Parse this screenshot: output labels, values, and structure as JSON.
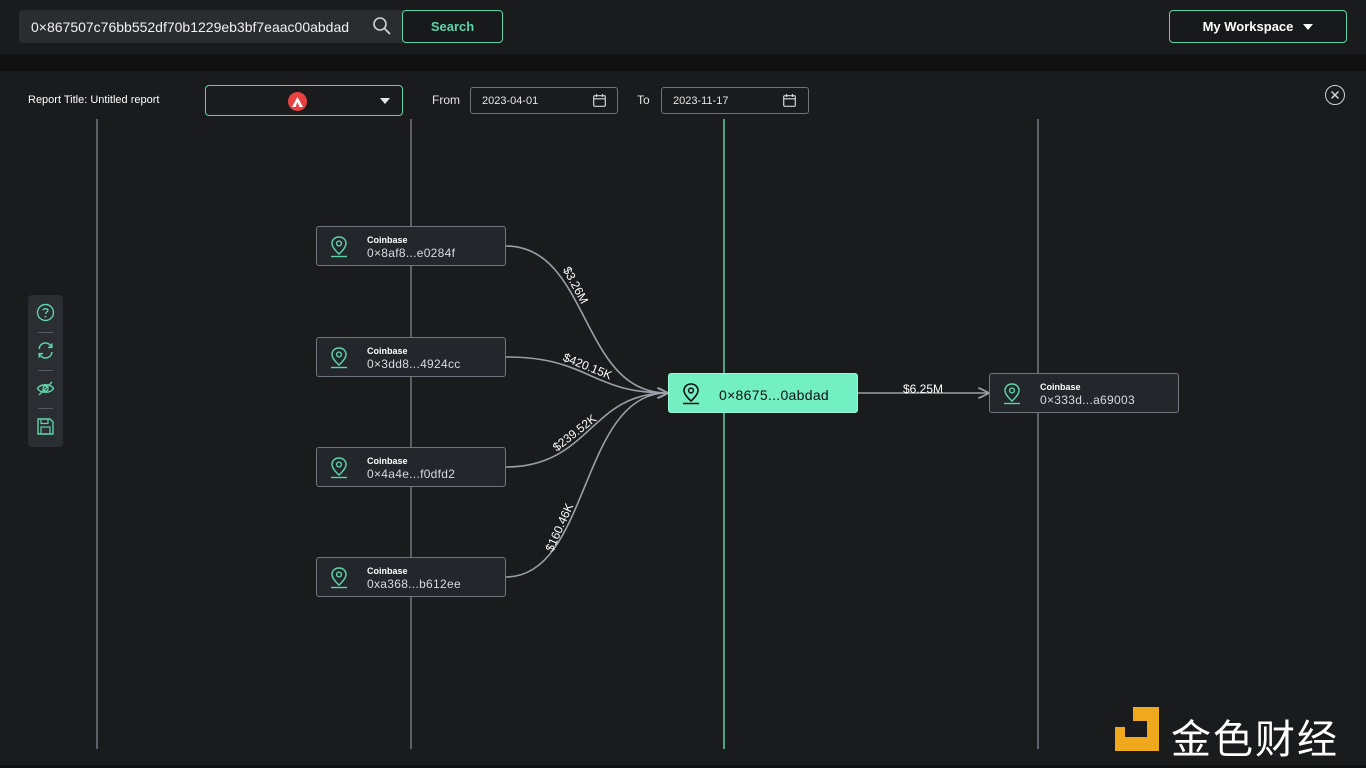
{
  "search": {
    "value": "0×867507c76bb552df70b1229eb3bf7eaac00abdad",
    "button_label": "Search"
  },
  "workspace": {
    "label": "My Workspace"
  },
  "report": {
    "title": "Report Title: Untitled report",
    "from_label": "From",
    "to_label": "To",
    "from_date": "2023-04-01",
    "to_date": "2023-11-17"
  },
  "colors": {
    "accent": "#5fd3a8",
    "center_node": "#72f0c4",
    "avalanche": "#e84142"
  },
  "toolbar": [
    "help-icon",
    "refresh-icon",
    "hide-icon",
    "save-icon"
  ],
  "sources": [
    {
      "label": "Coinbase",
      "address": "0×8af8...e0284f",
      "amount": "$3.26M"
    },
    {
      "label": "Coinbase",
      "address": "0×3dd8...4924cc",
      "amount": "$420.15K"
    },
    {
      "label": "Coinbase",
      "address": "0×4a4e...f0dfd2",
      "amount": "$239.52K"
    },
    {
      "label": "Coinbase",
      "address": "0xa368...b612ee",
      "amount": "$160.46K"
    }
  ],
  "center": {
    "address": "0×8675...0abdad"
  },
  "target": {
    "label": "Coinbase",
    "address": "0×333d...a69003",
    "amount": "$6.25M"
  },
  "watermark": {
    "text": "金色财经"
  }
}
